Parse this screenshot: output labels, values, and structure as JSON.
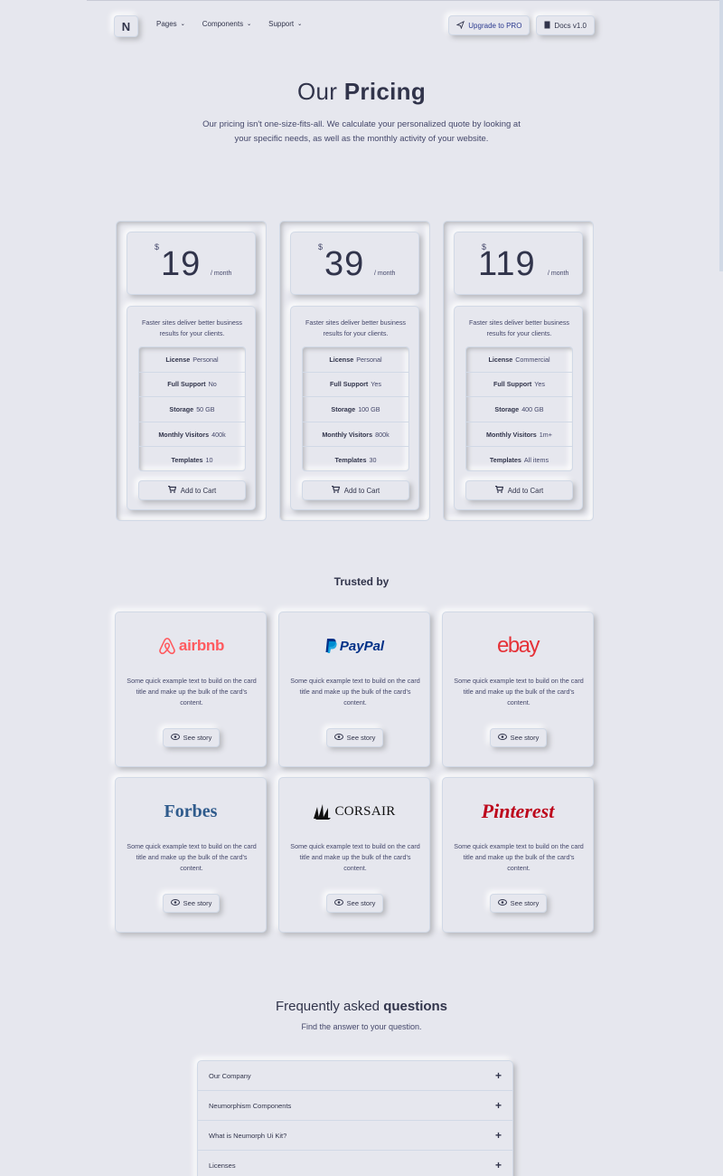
{
  "nav": {
    "brand": "N",
    "links": [
      {
        "label": "Pages"
      },
      {
        "label": "Components"
      },
      {
        "label": "Support"
      }
    ],
    "upgrade_label": "Upgrade to PRO",
    "docs_label": "Docs v1.0"
  },
  "hero": {
    "title_light": "Our ",
    "title_bold": "Pricing",
    "subtitle": "Our pricing isn't one-size-fits-all. We calculate your personalized quote by looking at your specific needs, as well as the monthly activity of your website."
  },
  "plans": [
    {
      "currency": "$",
      "price": "19",
      "period": "/ month",
      "description": "Faster sites deliver better business results for your clients.",
      "features": [
        {
          "name": "License",
          "value": "Personal"
        },
        {
          "name": "Full Support",
          "value": "No"
        },
        {
          "name": "Storage",
          "value": "50 GB"
        },
        {
          "name": "Monthly Visitors",
          "value": "400k"
        },
        {
          "name": "Templates",
          "value": "10"
        }
      ],
      "cta": "Add to Cart"
    },
    {
      "currency": "$",
      "price": "39",
      "period": "/ month",
      "description": "Faster sites deliver better business results for your clients.",
      "features": [
        {
          "name": "License",
          "value": "Personal"
        },
        {
          "name": "Full Support",
          "value": "Yes"
        },
        {
          "name": "Storage",
          "value": "100 GB"
        },
        {
          "name": "Monthly Visitors",
          "value": "800k"
        },
        {
          "name": "Templates",
          "value": "30"
        }
      ],
      "cta": "Add to Cart"
    },
    {
      "currency": "$",
      "price": "119",
      "period": "/ month",
      "description": "Faster sites deliver better business results for your clients.",
      "features": [
        {
          "name": "License",
          "value": "Commercial"
        },
        {
          "name": "Full Support",
          "value": "Yes"
        },
        {
          "name": "Storage",
          "value": "400 GB"
        },
        {
          "name": "Monthly Visitors",
          "value": "1m+"
        },
        {
          "name": "Templates",
          "value": "All items"
        }
      ],
      "cta": "Add to Cart"
    }
  ],
  "trusted": {
    "title": "Trusted by",
    "brands": [
      {
        "logo": "airbnb",
        "logo_color": "#ff5a5f",
        "text": "Some quick example text to build on the card title and make up the bulk of the card's content.",
        "cta": "See story"
      },
      {
        "logo": "PayPal",
        "logo_color": "#003087",
        "text": "Some quick example text to build on the card title and make up the bulk of the card's content.",
        "cta": "See story"
      },
      {
        "logo": "ebay",
        "logo_color": "#e53238",
        "text": "Some quick example text to build on the card title and make up the bulk of the card's content.",
        "cta": "See story"
      },
      {
        "logo": "Forbes",
        "logo_color": "#2f5b8c",
        "text": "Some quick example text to build on the card title and make up the bulk of the card's content.",
        "cta": "See story"
      },
      {
        "logo": "CORSAIR",
        "logo_color": "#111111",
        "text": "Some quick example text to build on the card title and make up the bulk of the card's content.",
        "cta": "See story"
      },
      {
        "logo": "Pinterest",
        "logo_color": "#bd081c",
        "text": "Some quick example text to build on the card title and make up the bulk of the card's content.",
        "cta": "See story"
      }
    ]
  },
  "faq": {
    "title_light": "Frequently asked ",
    "title_bold": "questions",
    "subtitle": "Find the answer to your question.",
    "items": [
      {
        "label": "Our Company"
      },
      {
        "label": "Neumorphism Components"
      },
      {
        "label": "What is Neumorph Ui Kit?"
      },
      {
        "label": "Licenses"
      }
    ]
  },
  "colors": {
    "background": "#e6e7ee",
    "text": "#31344b",
    "shadow_dark": "#b8b9be",
    "shadow_light": "#ffffff"
  }
}
